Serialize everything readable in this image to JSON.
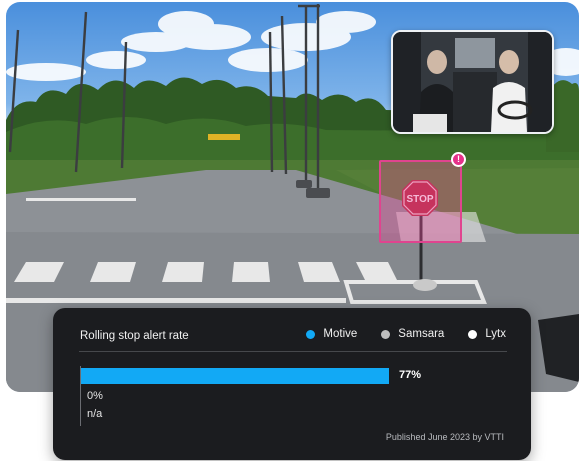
{
  "panel": {
    "title": "Rolling stop alert rate",
    "published": "Published June 2023 by VTTI"
  },
  "legend": [
    {
      "label": "Motive",
      "color": "#12a9f5"
    },
    {
      "label": "Samsara",
      "color": "#bdbdbd"
    },
    {
      "label": "Lytx",
      "color": "#ffffff"
    }
  ],
  "chart_data": {
    "type": "bar",
    "orientation": "horizontal",
    "title": "Rolling stop alert rate",
    "categories": [
      "Motive",
      "Samsara",
      "Lytx"
    ],
    "values": [
      77,
      0,
      null
    ],
    "value_labels": [
      "77%",
      "0%",
      "n/a"
    ],
    "xlim": [
      0,
      100
    ],
    "grid": false,
    "legend_position": "top-right"
  },
  "scene": {
    "stop_sign_text": "STOP",
    "alert_badge": "!"
  }
}
